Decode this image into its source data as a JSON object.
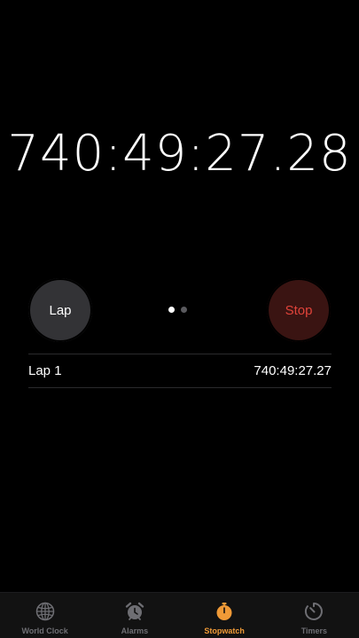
{
  "stopwatch": {
    "elapsed": "740:49:27.28"
  },
  "controls": {
    "lap_label": "Lap",
    "stop_label": "Stop"
  },
  "laps": [
    {
      "label": "Lap 1",
      "time": "740:49:27.27"
    }
  ],
  "tabs": [
    {
      "label": "World Clock",
      "icon": "globe-icon",
      "active": false
    },
    {
      "label": "Alarms",
      "icon": "alarm-clock-icon",
      "active": false
    },
    {
      "label": "Stopwatch",
      "icon": "stopwatch-icon",
      "active": true
    },
    {
      "label": "Timers",
      "icon": "timer-icon",
      "active": false
    }
  ],
  "colors": {
    "background": "#000000",
    "accent": "#f09a37",
    "stop_text": "#e0433a",
    "stop_bg": "#3a1412",
    "lap_bg": "#333336"
  }
}
